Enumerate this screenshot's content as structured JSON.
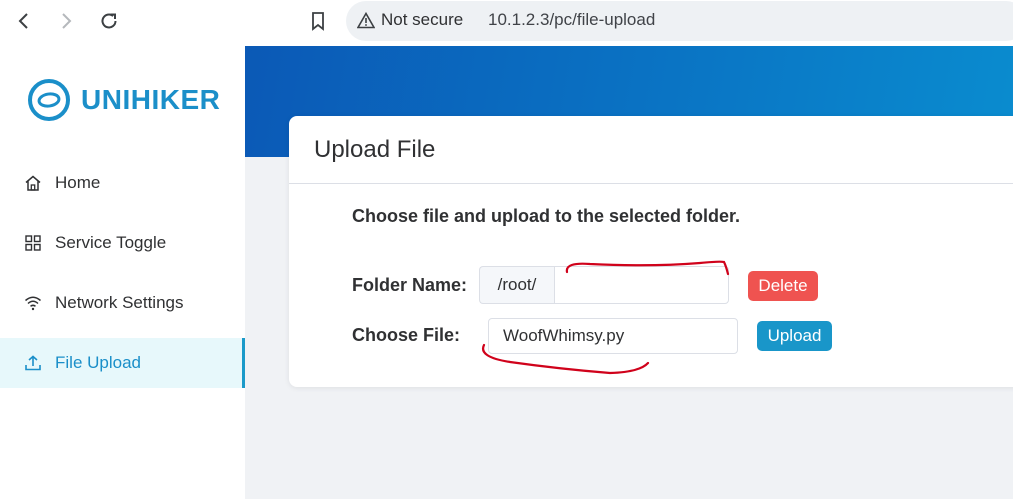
{
  "browser": {
    "security_label": "Not secure",
    "url": "10.1.2.3/pc/file-upload",
    "icons": [
      "back-icon",
      "forward-icon",
      "reload-icon",
      "bookmark-icon",
      "warning-icon"
    ]
  },
  "sidebar": {
    "logo_text": "UNIHIKER",
    "items": [
      {
        "label": "Home",
        "icon": "home-icon"
      },
      {
        "label": "Service Toggle",
        "icon": "grid-icon"
      },
      {
        "label": "Network Settings",
        "icon": "wifi-icon"
      },
      {
        "label": "File Upload",
        "icon": "upload-icon",
        "active": true
      }
    ]
  },
  "main": {
    "card_title": "Upload File",
    "instruction": "Choose file and upload to the selected folder.",
    "folder_label": "Folder Name:",
    "folder_prefix": "/root/",
    "folder_value": "",
    "delete_label": "Delete",
    "file_label": "Choose File:",
    "file_name": "WoofWhimsy.py",
    "upload_label": "Upload"
  },
  "colors": {
    "accent": "#1b8fc9",
    "delete": "#ef5350",
    "upload": "#1996c9",
    "banner": "#0a74c4",
    "annotation": "#d0021b"
  }
}
